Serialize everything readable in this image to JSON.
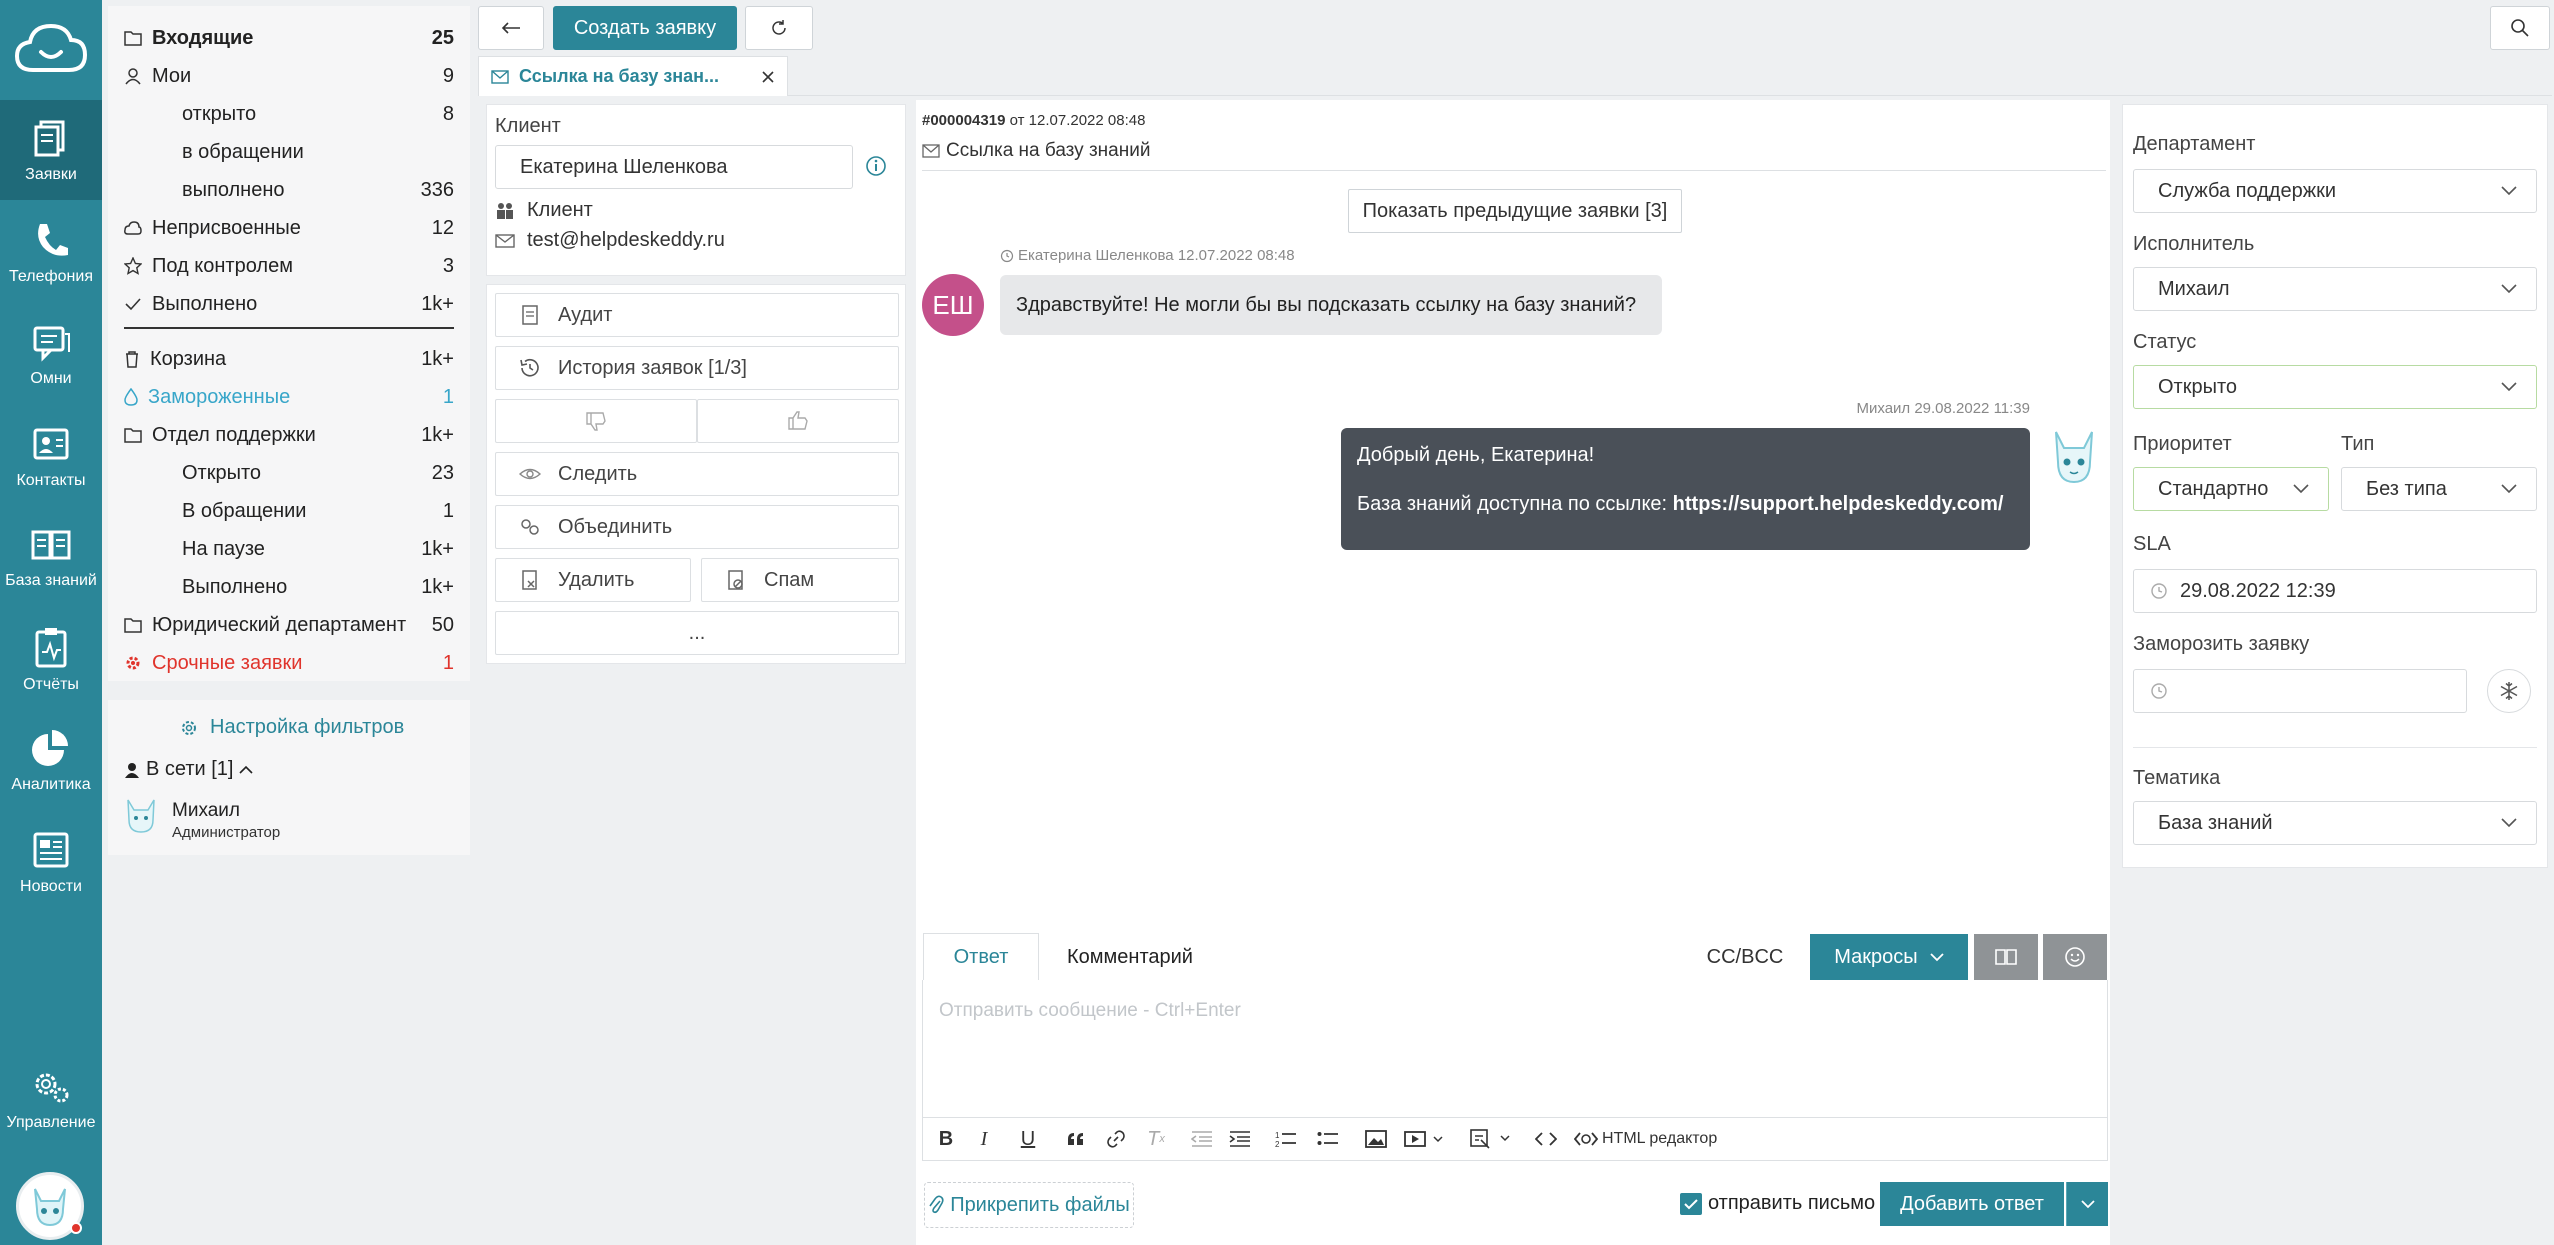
{
  "rail": {
    "items": [
      {
        "label": "Заявки",
        "icon": "tickets-icon"
      },
      {
        "label": "Телефония",
        "icon": "phone-icon"
      },
      {
        "label": "Омни",
        "icon": "omni-chat-icon"
      },
      {
        "label": "Контакты",
        "icon": "contacts-icon"
      },
      {
        "label": "База знаний",
        "icon": "book-icon"
      },
      {
        "label": "Отчёты",
        "icon": "reports-icon"
      },
      {
        "label": "Аналитика",
        "icon": "pie-chart-icon"
      },
      {
        "label": "Новости",
        "icon": "news-icon"
      }
    ],
    "settings_label": "Управление"
  },
  "filters": {
    "items": [
      {
        "label": "Входящие",
        "count": "25",
        "icon": "folder-icon"
      },
      {
        "label": "Мои",
        "count": "9",
        "icon": "user-icon"
      },
      {
        "label": "открыто",
        "count": "8"
      },
      {
        "label": "в обращении",
        "count": ""
      },
      {
        "label": "выполнено",
        "count": "336"
      },
      {
        "label": "Неприсвоенные",
        "count": "12",
        "icon": "cloud-icon"
      },
      {
        "label": "Под контролем",
        "count": "3",
        "icon": "star-icon"
      },
      {
        "label": "Выполнено",
        "count": "1k+",
        "icon": "check-icon"
      },
      {
        "label": "Корзина",
        "count": "1k+",
        "icon": "trash-icon"
      },
      {
        "label": "Замороженные",
        "count": "1",
        "icon": "drop-icon"
      },
      {
        "label": "Отдел поддержки",
        "count": "1k+",
        "icon": "folder-icon"
      },
      {
        "label": "Открыто",
        "count": "23"
      },
      {
        "label": "В обращении",
        "count": "1"
      },
      {
        "label": "На паузе",
        "count": "1k+"
      },
      {
        "label": "Выполнено",
        "count": "1k+"
      },
      {
        "label": "Юридический департамент",
        "count": "50",
        "icon": "folder-icon"
      },
      {
        "label": "Срочные заявки",
        "count": "1",
        "icon": "gear-icon"
      }
    ],
    "settings_link": "Настройка фильтров"
  },
  "online": {
    "title": "В сети [1]",
    "user_name": "Михаил",
    "user_role": "Администратор"
  },
  "toolbar": {
    "create_label": "Создать заявку"
  },
  "tab": {
    "title": "Ссылка на базу знан..."
  },
  "client": {
    "label": "Клиент",
    "name": "Екатерина Шеленкова",
    "type": "Клиент",
    "email": "test@helpdeskeddy.ru"
  },
  "actions": {
    "audit": "Аудит",
    "history": "История заявок [1/3]",
    "follow": "Следить",
    "merge": "Объединить",
    "delete": "Удалить",
    "spam": "Спам",
    "more": "..."
  },
  "ticket": {
    "number": "#000004319",
    "date": "от 12.07.2022 08:48",
    "subject": "Ссылка на базу знаний",
    "show_prev": "Показать предыдущие заявки [3]"
  },
  "messages": [
    {
      "author_meta": "Екатерина Шеленкова 12.07.2022 08:48",
      "initials": "ЕШ",
      "text": "Здравствуйте! Не могли бы вы подсказать ссылку на базу знаний?"
    },
    {
      "author_meta": "Михаил 29.08.2022 11:39",
      "line1": "Добрый день, Екатерина!",
      "line2_prefix": "База знаний доступна по ссылке: ",
      "line2_link": "https://support.helpdeskeddy.com/"
    }
  ],
  "editor": {
    "tab_reply": "Ответ",
    "tab_comment": "Комментарий",
    "ccbcc": "CC/BCC",
    "macros": "Макросы",
    "placeholder": "Отправить сообщение - Ctrl+Enter",
    "html_editor": "HTML редактор",
    "attach": "Прикрепить файлы",
    "send_email": "отправить письмо",
    "submit": "Добавить ответ"
  },
  "props": {
    "department_label": "Департамент",
    "department_value": "Служба поддержки",
    "assignee_label": "Исполнитель",
    "assignee_value": "Михаил",
    "status_label": "Статус",
    "status_value": "Открыто",
    "priority_label": "Приоритет",
    "priority_value": "Стандартно",
    "type_label": "Тип",
    "type_value": "Без типа",
    "sla_label": "SLA",
    "sla_value": "29.08.2022 12:39",
    "freeze_label": "Заморозить заявку",
    "topic_label": "Тематика",
    "topic_value": "База знаний"
  },
  "colors": {
    "brand": "#2b8698",
    "danger": "#e0342c",
    "frozen": "#38a6c9",
    "status_border": "#b7dba2",
    "avatar": "#c4508a"
  }
}
